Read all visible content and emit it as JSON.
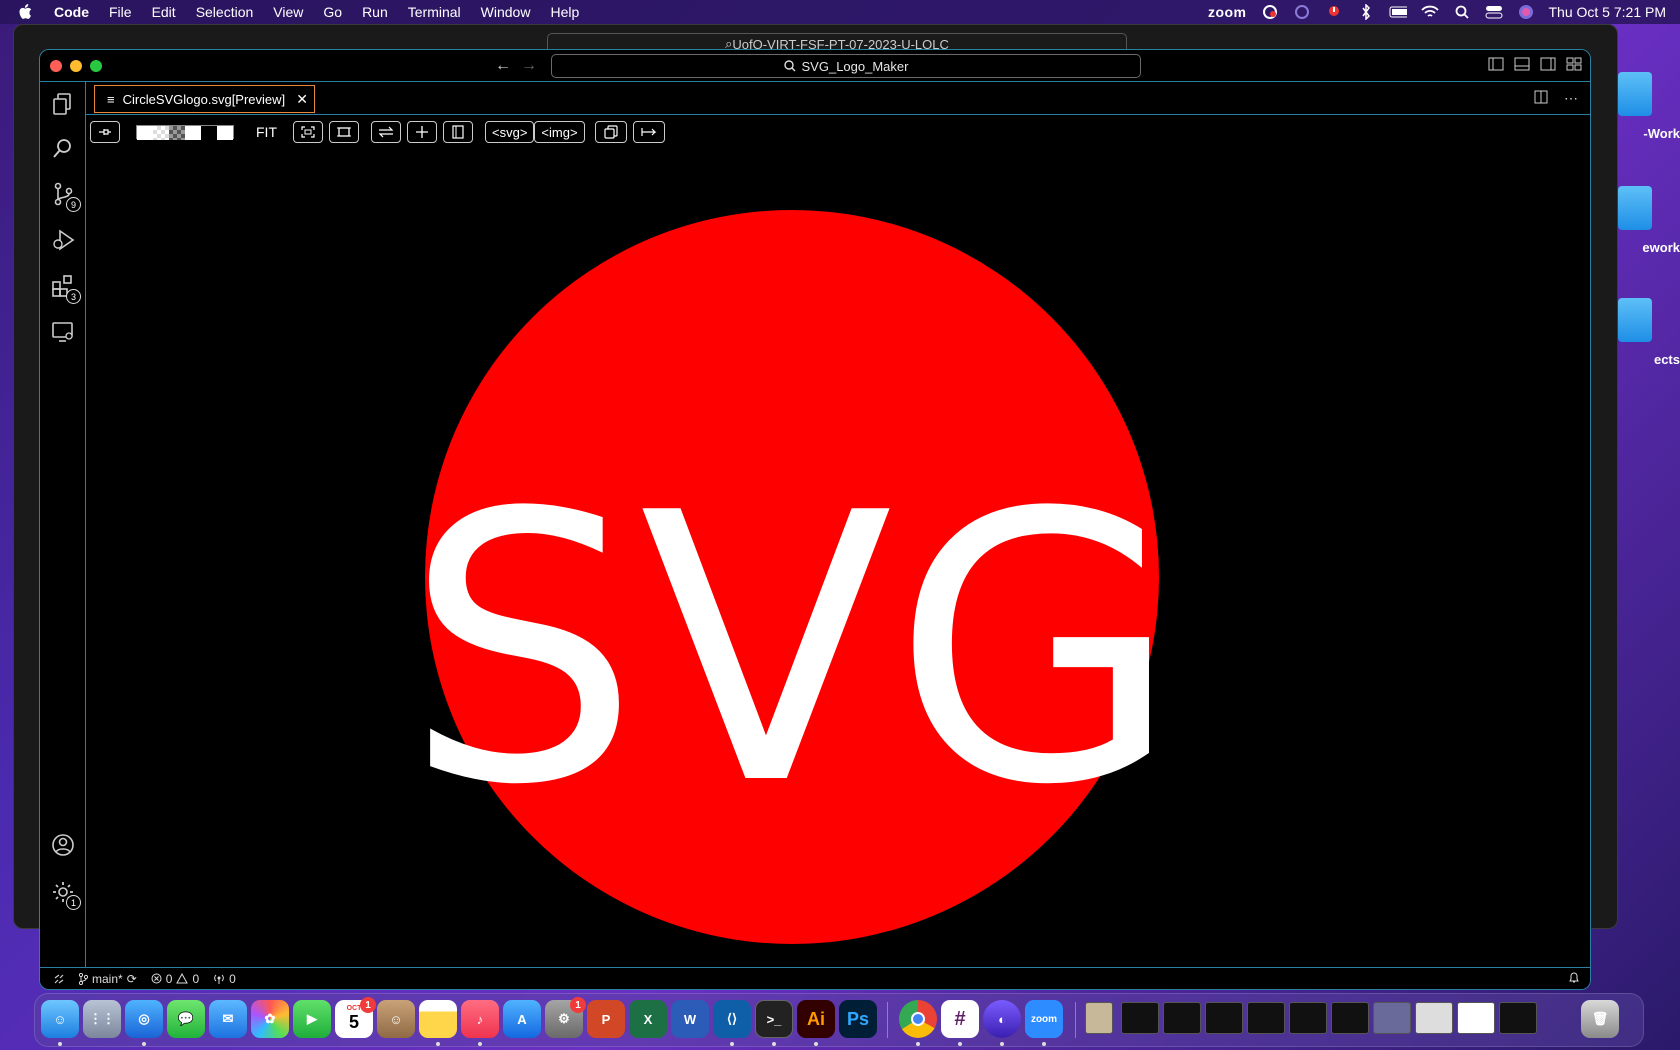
{
  "menubar": {
    "app": "Code",
    "items": [
      "File",
      "Edit",
      "Selection",
      "View",
      "Go",
      "Run",
      "Terminal",
      "Window",
      "Help"
    ],
    "zoom_label": "zoom",
    "clock": "Thu Oct 5  7:21 PM"
  },
  "desktop": {
    "folders": [
      "-Work",
      "ework",
      "ects"
    ]
  },
  "background_window": {
    "search": "UofO-VIRT-FSF-PT-07-2023-U-LOLC"
  },
  "window": {
    "search": "SVG_Logo_Maker"
  },
  "activity_badges": {
    "source_control": "9",
    "extensions": "3",
    "settings": "1"
  },
  "tab": {
    "label": "CircleSVGlogo.svg[Preview]",
    "close": "✕"
  },
  "toolbar": {
    "fit": "FIT",
    "svg": "<svg>",
    "img": "<img>"
  },
  "preview": {
    "text": "SVG",
    "circle_fill": "#ff0000",
    "text_fill": "#ffffff",
    "background": "#000000"
  },
  "statusbar": {
    "branch": "main*",
    "errors": "0",
    "warnings": "0",
    "ports": "0"
  },
  "dock": {
    "calendar_month": "OCT",
    "calendar_day": "5",
    "calendar_badge": "1",
    "settings_badge": "1",
    "zoom_label": "zoom",
    "illustrator": "Ai",
    "photoshop": "Ps"
  }
}
